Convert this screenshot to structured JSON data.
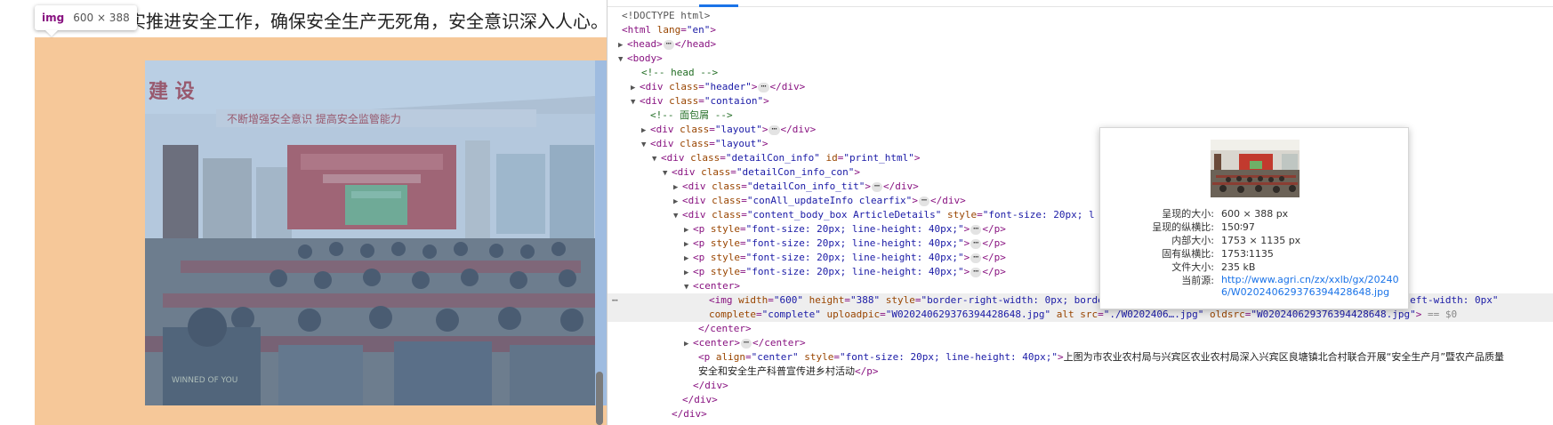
{
  "page": {
    "article_line": "实推进安全工作，确保安全生产无死角，安全意识深入人心。",
    "tooltip": {
      "tag": "img",
      "dims": "600 × 388"
    },
    "photo_banner": "不断增强安全意识 提高安全监管能力",
    "photo_wall_left": "建 设",
    "photo_shirt": "WINNED OF YOU"
  },
  "devtools": {
    "lines": [
      {
        "parts": [
          [
            "t-doc",
            "<!DOCTYPE html>"
          ]
        ]
      },
      {
        "parts": [
          [
            "t-tag",
            "<html "
          ],
          [
            "t-attr",
            "lang"
          ],
          [
            "t-tag",
            "="
          ],
          [
            "t-val",
            "\"en\""
          ],
          [
            "t-tag",
            ">"
          ]
        ]
      },
      {
        "parts": [
          [
            "t-tag",
            "<head>"
          ],
          [
            "ell",
            "⋯"
          ],
          [
            "t-tag",
            "</head>"
          ]
        ]
      },
      {
        "parts": [
          [
            "t-tag",
            "<body>"
          ]
        ]
      },
      {
        "parts": [
          [
            "t-cmt",
            "<!-- head -->"
          ]
        ]
      },
      {
        "parts": [
          [
            "t-tag",
            "<div "
          ],
          [
            "t-attr",
            "class"
          ],
          [
            "t-tag",
            "="
          ],
          [
            "t-val",
            "\"header\""
          ],
          [
            "t-tag",
            ">"
          ],
          [
            "ell",
            "⋯"
          ],
          [
            "t-tag",
            "</div>"
          ]
        ]
      },
      {
        "parts": [
          [
            "t-tag",
            "<div "
          ],
          [
            "t-attr",
            "class"
          ],
          [
            "t-tag",
            "="
          ],
          [
            "t-val",
            "\"contaion\""
          ],
          [
            "t-tag",
            ">"
          ]
        ]
      },
      {
        "parts": [
          [
            "t-cmt",
            "<!-- 面包屑 -->"
          ]
        ]
      },
      {
        "parts": [
          [
            "t-tag",
            "<div "
          ],
          [
            "t-attr",
            "class"
          ],
          [
            "t-tag",
            "="
          ],
          [
            "t-val",
            "\"layout\""
          ],
          [
            "t-tag",
            ">"
          ],
          [
            "ell",
            "⋯"
          ],
          [
            "t-tag",
            "</div>"
          ]
        ]
      },
      {
        "parts": [
          [
            "t-tag",
            "<div "
          ],
          [
            "t-attr",
            "class"
          ],
          [
            "t-tag",
            "="
          ],
          [
            "t-val",
            "\"layout\""
          ],
          [
            "t-tag",
            ">"
          ]
        ]
      },
      {
        "parts": [
          [
            "t-tag",
            "<div "
          ],
          [
            "t-attr",
            "class"
          ],
          [
            "t-tag",
            "="
          ],
          [
            "t-val",
            "\"detailCon_info\""
          ],
          [
            "t-tag",
            " "
          ],
          [
            "t-attr",
            "id"
          ],
          [
            "t-tag",
            "="
          ],
          [
            "t-val",
            "\"print_html\""
          ],
          [
            "t-tag",
            ">"
          ]
        ]
      },
      {
        "parts": [
          [
            "t-tag",
            "<div "
          ],
          [
            "t-attr",
            "class"
          ],
          [
            "t-tag",
            "="
          ],
          [
            "t-val",
            "\"detailCon_info_con\""
          ],
          [
            "t-tag",
            ">"
          ]
        ]
      },
      {
        "parts": [
          [
            "t-tag",
            "<div "
          ],
          [
            "t-attr",
            "class"
          ],
          [
            "t-tag",
            "="
          ],
          [
            "t-val",
            "\"detailCon_info_tit\""
          ],
          [
            "t-tag",
            ">"
          ],
          [
            "ell",
            "⋯"
          ],
          [
            "t-tag",
            "</div>"
          ]
        ]
      },
      {
        "parts": [
          [
            "t-tag",
            "<div "
          ],
          [
            "t-attr",
            "class"
          ],
          [
            "t-tag",
            "="
          ],
          [
            "t-val",
            "\"conAll_updateInfo clearfix\""
          ],
          [
            "t-tag",
            ">"
          ],
          [
            "ell",
            "⋯"
          ],
          [
            "t-tag",
            "</div>"
          ]
        ]
      },
      {
        "parts": [
          [
            "t-tag",
            "<div "
          ],
          [
            "t-attr",
            "class"
          ],
          [
            "t-tag",
            "="
          ],
          [
            "t-val",
            "\"content_body_box ArticleDetails\""
          ],
          [
            "t-tag",
            " "
          ],
          [
            "t-attr",
            "style"
          ],
          [
            "t-tag",
            "="
          ],
          [
            "t-val",
            "\"font-size: 20px; l"
          ]
        ]
      },
      {
        "parts": [
          [
            "t-tag",
            "<p "
          ],
          [
            "t-attr",
            "style"
          ],
          [
            "t-tag",
            "="
          ],
          [
            "t-val",
            "\"font-size: 20px; line-height: 40px;\""
          ],
          [
            "t-tag",
            ">"
          ],
          [
            "ell",
            "⋯"
          ],
          [
            "t-tag",
            "</p>"
          ]
        ]
      },
      {
        "parts": [
          [
            "t-tag",
            "<p "
          ],
          [
            "t-attr",
            "style"
          ],
          [
            "t-tag",
            "="
          ],
          [
            "t-val",
            "\"font-size: 20px; line-height: 40px;\""
          ],
          [
            "t-tag",
            ">"
          ],
          [
            "ell",
            "⋯"
          ],
          [
            "t-tag",
            "</p>"
          ]
        ]
      },
      {
        "parts": [
          [
            "t-tag",
            "<p "
          ],
          [
            "t-attr",
            "style"
          ],
          [
            "t-tag",
            "="
          ],
          [
            "t-val",
            "\"font-size: 20px; line-height: 40px;\""
          ],
          [
            "t-tag",
            ">"
          ],
          [
            "ell",
            "⋯"
          ],
          [
            "t-tag",
            "</p>"
          ]
        ]
      },
      {
        "parts": [
          [
            "t-tag",
            "<p "
          ],
          [
            "t-attr",
            "style"
          ],
          [
            "t-tag",
            "="
          ],
          [
            "t-val",
            "\"font-size: 20px; line-height: 40px;\""
          ],
          [
            "t-tag",
            ">"
          ],
          [
            "ell",
            "⋯"
          ],
          [
            "t-tag",
            "</p>"
          ]
        ]
      },
      {
        "parts": [
          [
            "t-tag",
            "<center>"
          ]
        ]
      },
      {
        "parts": [
          [
            "t-tag",
            "<img "
          ],
          [
            "t-attr",
            "width"
          ],
          [
            "t-tag",
            "="
          ],
          [
            "t-val",
            "\"600\""
          ],
          [
            "t-tag",
            " "
          ],
          [
            "t-attr",
            "height"
          ],
          [
            "t-tag",
            "="
          ],
          [
            "t-val",
            "\"388\""
          ],
          [
            "t-tag",
            " "
          ],
          [
            "t-attr",
            "style"
          ],
          [
            "t-tag",
            "="
          ],
          [
            "t-val",
            "\"border-right-width: 0px; border-top-width: 0px; border-bottom-width: 0px; border-left-width: 0px\""
          ]
        ],
        "parts2": [
          [
            "t-attr",
            "complete"
          ],
          [
            "t-tag",
            "="
          ],
          [
            "t-val",
            "\"complete\""
          ],
          [
            "t-tag",
            " "
          ],
          [
            "t-attr",
            "uploadpic"
          ],
          [
            "t-tag",
            "="
          ],
          [
            "t-val",
            "\"W020240629376394428648.jpg\""
          ],
          [
            "t-tag",
            " "
          ],
          [
            "t-attr",
            "alt"
          ],
          [
            "t-tag",
            " "
          ],
          [
            "t-attr",
            "src"
          ],
          [
            "t-tag",
            "="
          ],
          [
            "t-val",
            "\"./W0202406….jpg\""
          ],
          [
            "t-tag",
            " "
          ],
          [
            "t-attr",
            "oldsrc"
          ],
          [
            "t-tag",
            "="
          ],
          [
            "t-val",
            "\"W020240629376394428648.jpg\""
          ],
          [
            "t-tag",
            ">"
          ],
          [
            "t-eq0",
            " == $0"
          ]
        ]
      },
      {
        "parts": [
          [
            "t-tag",
            "</center>"
          ]
        ]
      },
      {
        "parts": [
          [
            "t-tag",
            "<center>"
          ],
          [
            "ell",
            "⋯"
          ],
          [
            "t-tag",
            "</center>"
          ]
        ]
      },
      {
        "parts": [
          [
            "t-tag",
            "<p "
          ],
          [
            "t-attr",
            "align"
          ],
          [
            "t-tag",
            "="
          ],
          [
            "t-val",
            "\"center\""
          ],
          [
            "t-tag",
            " "
          ],
          [
            "t-attr",
            "style"
          ],
          [
            "t-tag",
            "="
          ],
          [
            "t-val",
            "\"font-size: 20px; line-height: 40px;\""
          ],
          [
            "t-tag",
            ">"
          ],
          [
            "t-text",
            "上图为市农业农村局与兴宾区农业农村局深入兴宾区良塘镇北合村联合开展“安全生产月”暨农产品质量"
          ]
        ],
        "parts2": [
          [
            "t-text",
            "安全和安全生产科普宣传进乡村活动"
          ],
          [
            "t-tag",
            "</p>"
          ]
        ]
      },
      {
        "parts": [
          [
            "t-tag",
            "</div>"
          ]
        ]
      },
      {
        "parts": [
          [
            "t-tag",
            "</div>"
          ]
        ]
      },
      {
        "parts": [
          [
            "t-tag",
            "</div>"
          ]
        ]
      }
    ],
    "hover_card": {
      "rows": [
        {
          "k": "呈现的大小:",
          "v": "600 × 388 px"
        },
        {
          "k": "呈现的纵横比:",
          "v": "150∶97"
        },
        {
          "k": "内部大小:",
          "v": "1753 × 1135 px"
        },
        {
          "k": "固有纵横比:",
          "v": "1753∶1135"
        },
        {
          "k": "文件大小:",
          "v": "235 kB"
        },
        {
          "k": "当前源:",
          "v": "http://www.agri.cn/zx/xxlb/gx/202406/W020240629376394428648.jpg",
          "link": true
        }
      ]
    }
  }
}
